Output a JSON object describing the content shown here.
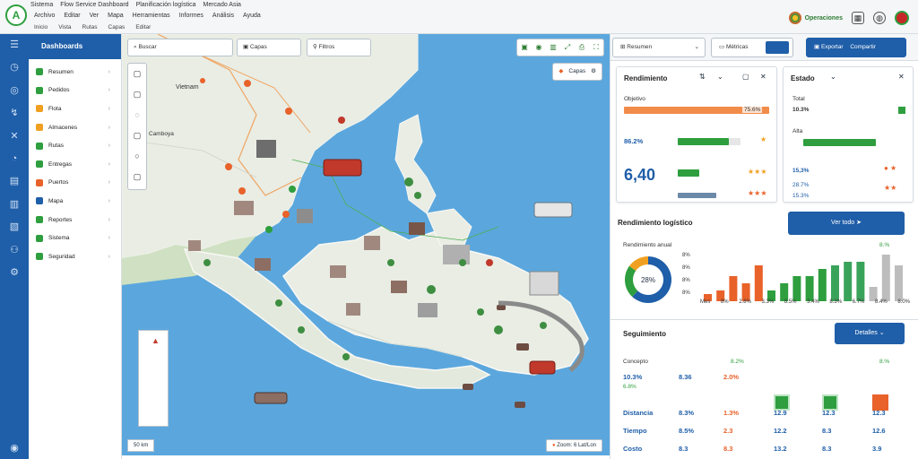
{
  "app": {
    "top_tabs": [
      "Sistema",
      "Flow Service Dashboard",
      "Planificación logística",
      "Mercado Asia"
    ],
    "menu": [
      "Archivo",
      "Editar",
      "Ver",
      "Mapa",
      "Herramientas",
      "Informes",
      "Análisis",
      "Ayuda"
    ],
    "submenu": [
      "Inicio",
      "Vista",
      "Rutas",
      "Capas",
      "Editar"
    ],
    "brand_label": "Operaciones",
    "window_icons": [
      "grid-icon",
      "globe-icon",
      "avatar"
    ]
  },
  "icon_rail": [
    "home-icon",
    "clock-icon",
    "globe-icon",
    "route-icon",
    "compass-icon",
    "document-icon",
    "table-icon",
    "chart-icon",
    "truck-icon",
    "settings-icon"
  ],
  "sidebar": {
    "header": "Dashboards",
    "items": [
      {
        "label": "Resumen",
        "color": "#2e9e3e"
      },
      {
        "label": "Pedidos",
        "color": "#2e9e3e"
      },
      {
        "label": "Flota",
        "color": "#f0a020"
      },
      {
        "label": "Almacenes",
        "color": "#f0a020"
      },
      {
        "label": "Rutas",
        "color": "#2e9e3e"
      },
      {
        "label": "Entregas",
        "color": "#2e9e3e"
      },
      {
        "label": "Puertos",
        "color": "#e8622a"
      },
      {
        "label": "Mapa",
        "color": "#1f5ea8"
      },
      {
        "label": "Reportes",
        "color": "#2e9e3e"
      },
      {
        "label": "Sistema",
        "color": "#2e9e3e"
      },
      {
        "label": "Seguridad",
        "color": "#2e9e3e"
      }
    ]
  },
  "map": {
    "search1": "Buscar",
    "search2": "Capas",
    "search3": "Filtros",
    "region_label_1": "Vietnam",
    "region_label_2": "Camboya",
    "layer_button": "Capas",
    "scale_text": "50 km",
    "status_text": "Zoom: 6  Lat/Lon",
    "tool_icons": [
      "layers-icon",
      "pin-icon",
      "chart-icon",
      "measure-icon",
      "fullscreen-icon"
    ],
    "zoom_icons": [
      "plus-icon",
      "minus-icon",
      "locate-icon",
      "compass-icon",
      "3d-icon",
      "info-icon"
    ]
  },
  "panel": {
    "tab1": "Resumen",
    "tab2": "Métricas",
    "tab3": "Exportar",
    "tab3_secondary": "Compartir",
    "card1": {
      "title": "Rendimiento",
      "row0_label": "Objetivo",
      "row0_value": "75.6%",
      "row1_value": "86.2%",
      "row1_fill": 0.82,
      "kpi": "6,40",
      "row2_fill": 0.34,
      "row3_fill": 0.62
    },
    "card2": {
      "title": "Estado",
      "row0_label": "Total",
      "row0_value": "10.3%",
      "row1_label": "Alta",
      "row1_value": "15,3%",
      "row1_fill": 0.9,
      "row2_value": "28.7%",
      "row3_value": "15.3%"
    },
    "chart_section_title": "Rendimiento logístico",
    "chart_button": "Ver todo",
    "chart_legend_left": "Rendimiento anual",
    "chart_legend_right": "8.%",
    "donut_value": "28%",
    "donut_parts": [
      0.62,
      0.23,
      0.15
    ],
    "table_title": "Seguimiento",
    "table_button": "Detalles",
    "table_header_left": "Concepto",
    "table_header_right1": "8.2%",
    "table_header_right2": "8.%",
    "rows": [
      {
        "label": "10.3%",
        "sub": "6.8%",
        "v1": "8.36",
        "v2": "2.0%",
        "v3": "",
        "v4": "",
        "v5": ""
      },
      {
        "label": "Distancia",
        "v1": "8.3%",
        "v2": "1.3%",
        "v3": "12.9",
        "v4": "12.3",
        "v5": "12.3"
      },
      {
        "label": "Tiempo",
        "v1": "8.5%",
        "v2": "2.3",
        "v3": "12.2",
        "v4": "8.3",
        "v5": "12.6"
      },
      {
        "label": "Costo",
        "v1": "8.3",
        "v2": "8.3",
        "v3": "13.2",
        "v4": "8.3",
        "v5": "3.9"
      }
    ]
  },
  "chart_data": {
    "type": "bar",
    "categories": [
      "1",
      "2",
      "3",
      "4",
      "5",
      "6",
      "7",
      "8",
      "9",
      "10",
      "11",
      "12",
      "13",
      "14",
      "15",
      "16"
    ],
    "values": [
      10,
      15,
      35,
      25,
      50,
      15,
      25,
      35,
      35,
      45,
      50,
      55,
      55,
      20,
      65,
      50
    ],
    "colors": [
      "#e8622a",
      "#e8622a",
      "#e8622a",
      "#e8622a",
      "#e8622a",
      "#2e9e3e",
      "#2e9e3e",
      "#2e9e3e",
      "#2e9e3e",
      "#2e9e3e",
      "#3aa35a",
      "#3aa35a",
      "#3aa35a",
      "#bdbdbd",
      "#bdbdbd",
      "#bdbdbd"
    ],
    "y_ticks": [
      "8%",
      "8%",
      "8%",
      "8%"
    ],
    "x_ticks": [
      "Mes",
      "8%",
      "2.8%",
      "3.3%",
      "8.5%",
      "3.4%",
      "8.3%",
      "6.7%",
      "8.4%",
      "8.0%"
    ],
    "ylim": [
      0,
      70
    ]
  }
}
